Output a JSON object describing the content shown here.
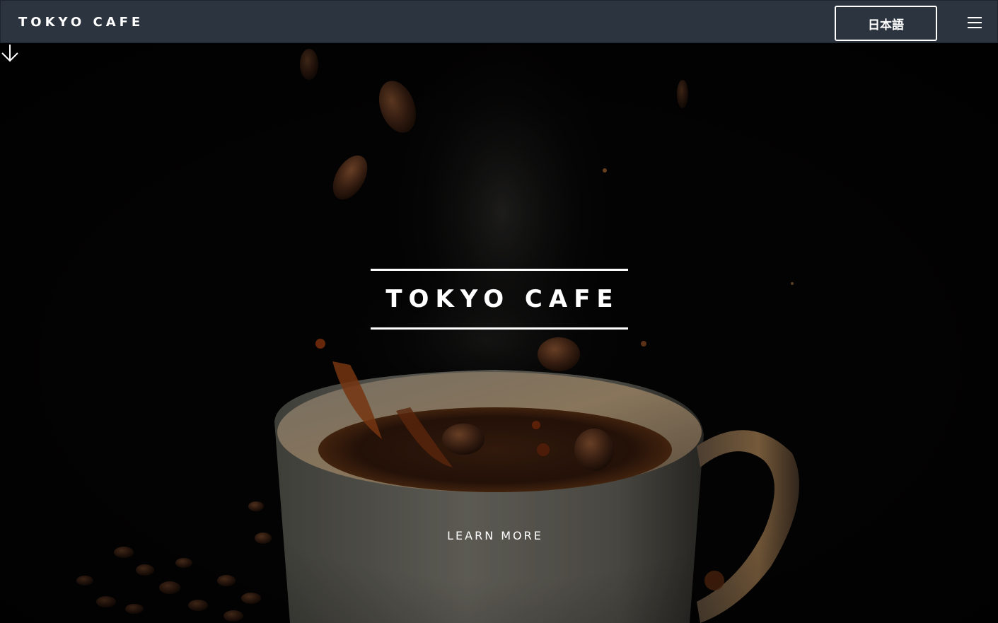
{
  "navbar": {
    "brand": "TOKYO CAFE",
    "language_button": "日本語",
    "menu_icon": "hamburger-menu-icon"
  },
  "hero": {
    "background_image": "coffee-cup-splash-with-falling-beans",
    "title": "TOKYO CAFE",
    "cta_label": "LEARN MORE",
    "cta_icon": "arrow-down-icon"
  },
  "colors": {
    "navbar_bg": "#2c343f",
    "text": "#ffffff",
    "hero_bg": "#040303"
  }
}
